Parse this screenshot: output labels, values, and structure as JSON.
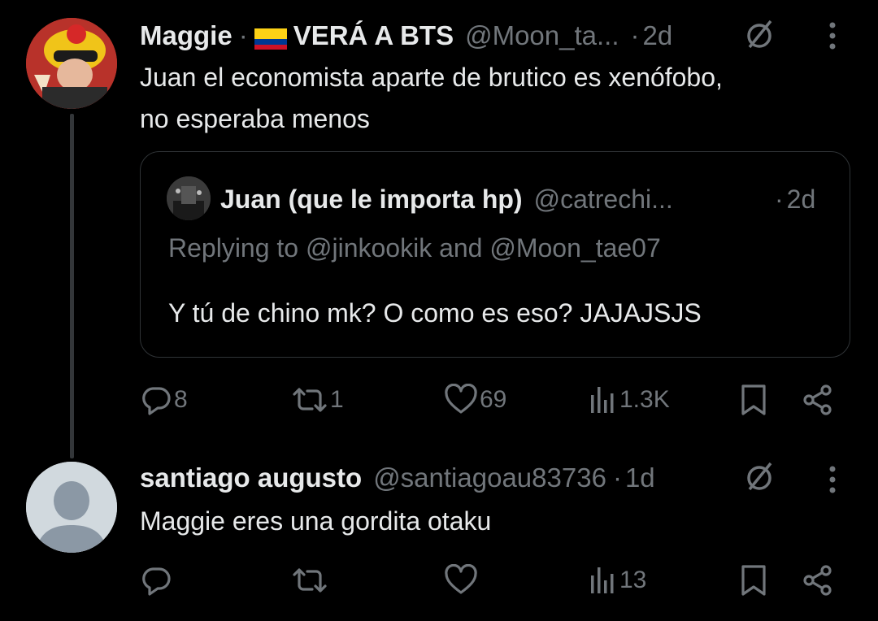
{
  "tweet1": {
    "author_name": "Maggie",
    "name_suffix": "VERÁ A BTS",
    "handle": "@Moon_ta...",
    "time": "2d",
    "body_line1": "Juan el economista aparte de brutico es xenófobo,",
    "body_line2": "no esperaba menos",
    "quote": {
      "author_name": "Juan (que le importa hp)",
      "handle": "@catrechi...",
      "time": "2d",
      "replying_to": "Replying to @jinkookik and @Moon_tae07",
      "text": "Y tú de chino mk? O como es eso? JAJAJSJS"
    },
    "actions": {
      "replies": "8",
      "retweets": "1",
      "likes": "69",
      "views": "1.3K"
    }
  },
  "tweet2": {
    "author_name": "santiago augusto",
    "handle": "@santiagoau83736",
    "time": "1d",
    "body": "Maggie eres una gordita otaku",
    "actions": {
      "views": "13"
    }
  },
  "colors": {
    "background": "#000000",
    "text": "#e7e9ea",
    "muted": "#71767b",
    "border": "#2f3336"
  },
  "icons": [
    "reply-icon",
    "retweet-icon",
    "like-icon",
    "views-icon",
    "bookmark-icon",
    "share-icon",
    "grok-icon",
    "more-icon"
  ]
}
